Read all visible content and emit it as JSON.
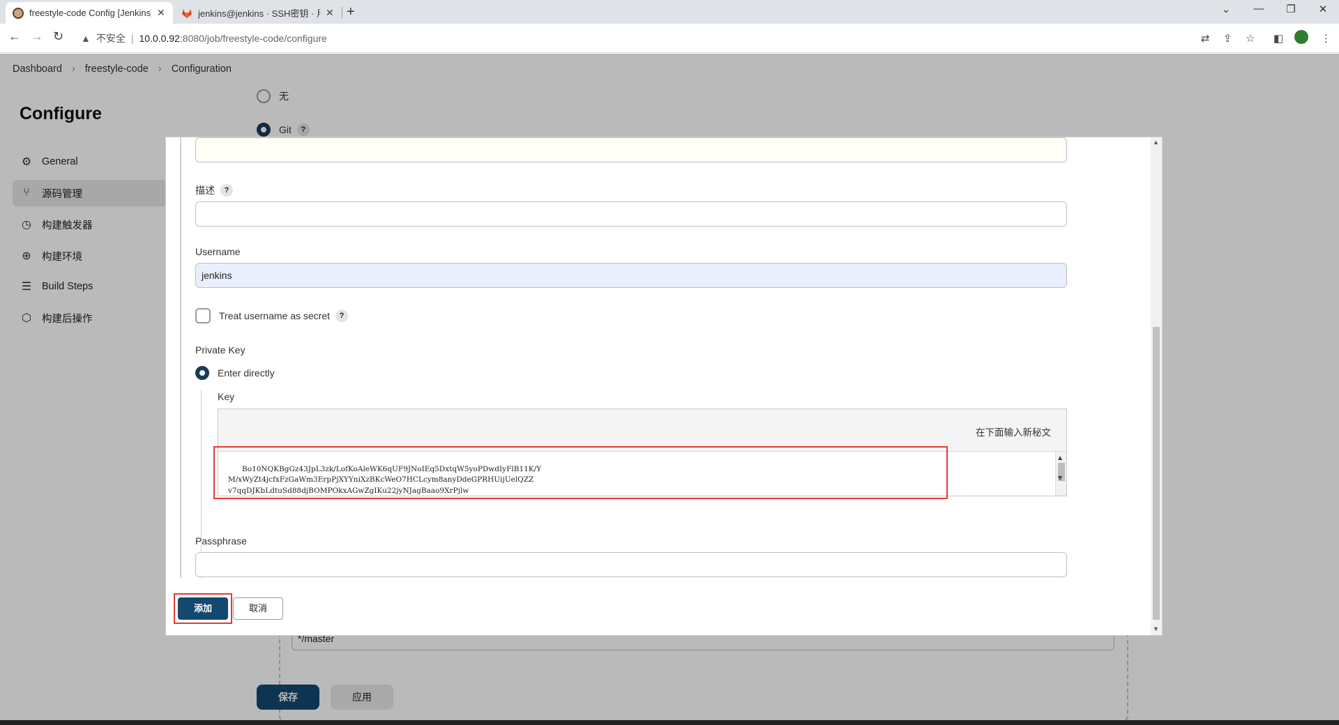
{
  "browser": {
    "tabs": [
      {
        "title": "freestyle-code Config [Jenkins]",
        "active": true
      },
      {
        "title": "jenkins@jenkins · SSH密钥 · 用户",
        "active": false
      }
    ],
    "new_tab": "+",
    "window_controls": {
      "dropdown": "⌄",
      "minimize": "—",
      "restore": "❐",
      "close": "✕"
    },
    "nav": {
      "back": "←",
      "forward": "→",
      "reload": "↻"
    },
    "address": {
      "warning_icon": "▲",
      "insecure": "不安全",
      "separator": "|",
      "host": "10.0.0.92",
      "rest": ":8080/job/freestyle-code/configure"
    }
  },
  "breadcrumb": [
    "Dashboard",
    "freestyle-code",
    "Configuration"
  ],
  "breadcrumb_sep": "›",
  "page_title": "Configure",
  "sidebar": {
    "items": [
      {
        "label": "General",
        "icon": "gear-icon",
        "glyph": "⚙"
      },
      {
        "label": "源码管理",
        "icon": "branch-icon",
        "glyph": "⑂"
      },
      {
        "label": "构建触发器",
        "icon": "clock-icon",
        "glyph": "◷"
      },
      {
        "label": "构建环境",
        "icon": "globe-icon",
        "glyph": "⊕"
      },
      {
        "label": "Build Steps",
        "icon": "list-icon",
        "glyph": "☰"
      },
      {
        "label": "构建后操作",
        "icon": "package-icon",
        "glyph": "⬡"
      }
    ]
  },
  "scm": {
    "options": [
      {
        "label": "无",
        "selected": false
      },
      {
        "label": "Git",
        "selected": true
      }
    ],
    "help": "?",
    "branch_value": "*/master"
  },
  "actions": {
    "save": "保存",
    "apply": "应用"
  },
  "dialog": {
    "top_field_value": "",
    "description_label": "描述",
    "description_value": "",
    "username_label": "Username",
    "username_value": "jenkins",
    "treat_secret_label": "Treat username as secret",
    "private_key_label": "Private Key",
    "enter_directly_label": "Enter directly",
    "key_label": "Key",
    "key_hint": "在下面输入新秘文",
    "key_text": "Bo10NQKBgGz43JpL3zk/LofKoAleWK6qUF9JNoIEq5DxtqW5yoPDwdIyFlB11K/Y\nM/xWyZt4jcfxFzGaWm3ErpPjXYYniXzBKcWeO7HCLcym8anyDdeGPRHUijUelQZZ\nv7qqDJKbLdtuSd88djBOMPOkxAGwZgIKu22jyNJagBaao9XrPjlw\n-----END RSA PRIVATE KEY-----",
    "passphrase_label": "Passphrase",
    "passphrase_value": "",
    "add_button": "添加",
    "cancel_button": "取消"
  },
  "colors": {
    "primary": "#13486f",
    "highlight_box": "#e53935",
    "filled_input": "#e8eefb"
  }
}
